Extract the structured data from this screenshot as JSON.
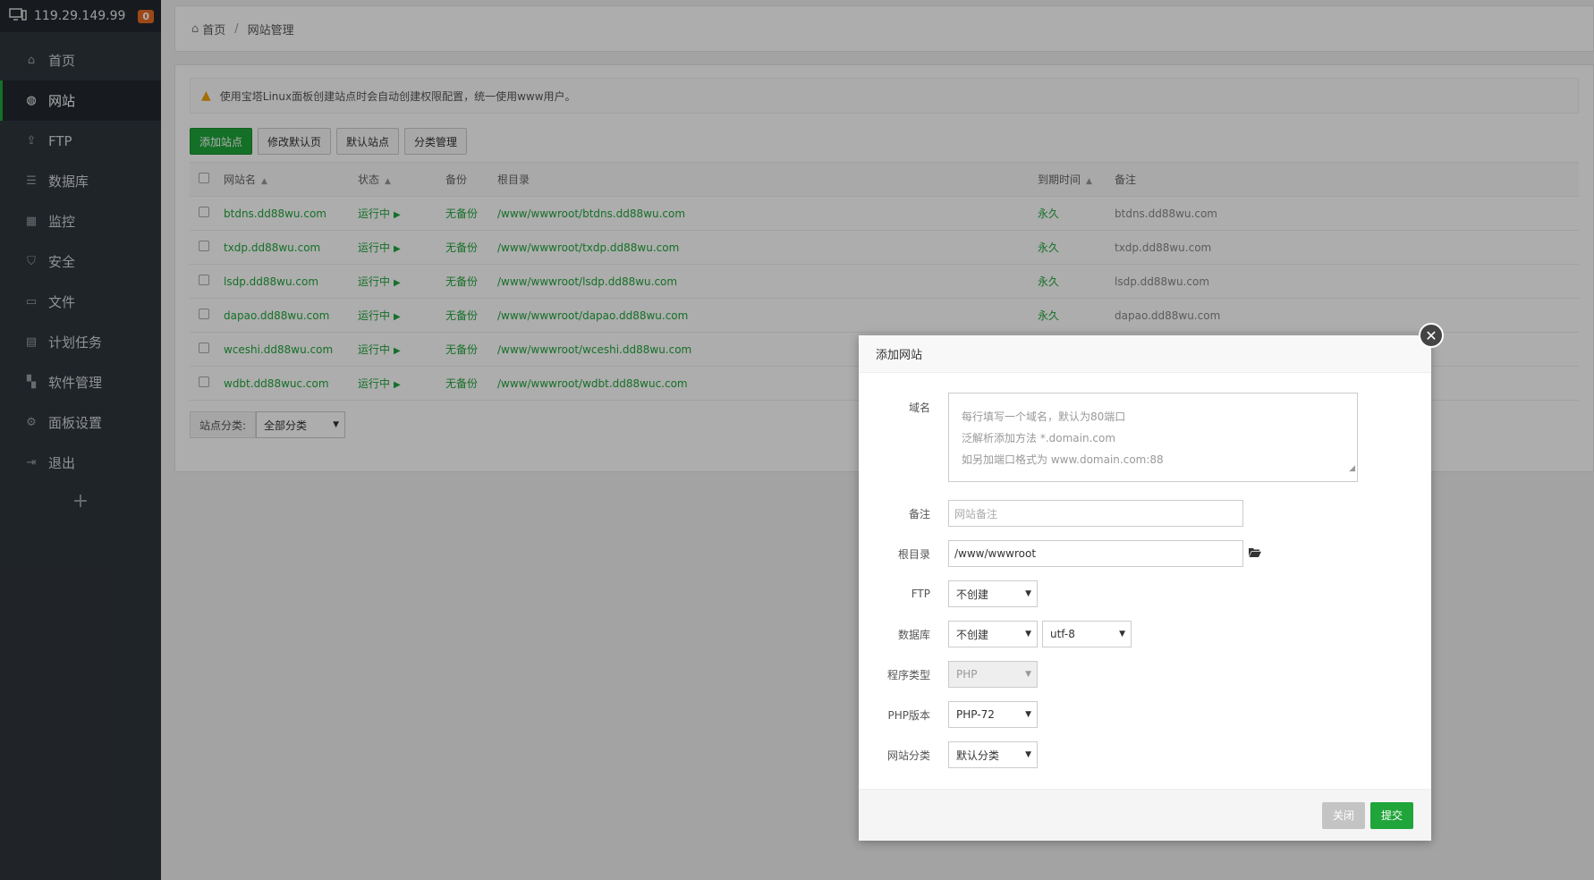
{
  "sidebar": {
    "ip": "119.29.149.99",
    "badge": "0",
    "items": [
      {
        "label": "首页",
        "icon": "home-icon"
      },
      {
        "label": "网站",
        "icon": "globe-icon"
      },
      {
        "label": "FTP",
        "icon": "ftp-icon"
      },
      {
        "label": "数据库",
        "icon": "database-icon"
      },
      {
        "label": "监控",
        "icon": "monitor-icon"
      },
      {
        "label": "安全",
        "icon": "shield-icon"
      },
      {
        "label": "文件",
        "icon": "folder-icon"
      },
      {
        "label": "计划任务",
        "icon": "calendar-icon"
      },
      {
        "label": "软件管理",
        "icon": "grid-icon"
      },
      {
        "label": "面板设置",
        "icon": "gear-icon"
      },
      {
        "label": "退出",
        "icon": "logout-icon"
      }
    ],
    "add": "+"
  },
  "breadcrumb": {
    "home": "首页",
    "sep": "/",
    "current": "网站管理"
  },
  "notice": "使用宝塔Linux面板创建站点时会自动创建权限配置，统一使用www用户。",
  "toolbar": {
    "add_site": "添加站点",
    "edit_default_page": "修改默认页",
    "default_site": "默认站点",
    "category_manage": "分类管理"
  },
  "table": {
    "headers": {
      "name": "网站名",
      "status": "状态",
      "backup": "备份",
      "path": "根目录",
      "expire": "到期时间",
      "note": "备注"
    },
    "rows": [
      {
        "name": "btdns.dd88wu.com",
        "status": "运行中",
        "backup": "无备份",
        "path": "/www/wwwroot/btdns.dd88wu.com",
        "expire": "永久",
        "note": "btdns.dd88wu.com"
      },
      {
        "name": "txdp.dd88wu.com",
        "status": "运行中",
        "backup": "无备份",
        "path": "/www/wwwroot/txdp.dd88wu.com",
        "expire": "永久",
        "note": "txdp.dd88wu.com"
      },
      {
        "name": "lsdp.dd88wu.com",
        "status": "运行中",
        "backup": "无备份",
        "path": "/www/wwwroot/lsdp.dd88wu.com",
        "expire": "永久",
        "note": "lsdp.dd88wu.com"
      },
      {
        "name": "dapao.dd88wu.com",
        "status": "运行中",
        "backup": "无备份",
        "path": "/www/wwwroot/dapao.dd88wu.com",
        "expire": "永久",
        "note": "dapao.dd88wu.com"
      },
      {
        "name": "wceshi.dd88wu.com",
        "status": "运行中",
        "backup": "无备份",
        "path": "/www/wwwroot/wceshi.dd88wu.com",
        "expire": "",
        "note": ""
      },
      {
        "name": "wdbt.dd88wuc.com",
        "status": "运行中",
        "backup": "无备份",
        "path": "/www/wwwroot/wdbt.dd88wuc.com",
        "expire": "",
        "note": ""
      }
    ]
  },
  "filter": {
    "label": "站点分类:",
    "value": "全部分类"
  },
  "modal": {
    "title": "添加网站",
    "domain_label": "域名",
    "domain_placeholder_lines": [
      "每行填写一个域名，默认为80端口",
      "泛解析添加方法 *.domain.com",
      "如另加端口格式为 www.domain.com:88"
    ],
    "note_label": "备注",
    "note_placeholder": "网站备注",
    "root_label": "根目录",
    "root_value": "/www/wwwroot",
    "ftp_label": "FTP",
    "ftp_value": "不创建",
    "db_label": "数据库",
    "db_value": "不创建",
    "db_charset": "utf-8",
    "prog_label": "程序类型",
    "prog_value": "PHP",
    "php_label": "PHP版本",
    "php_value": "PHP-72",
    "cat_label": "网站分类",
    "cat_value": "默认分类",
    "close": "关闭",
    "submit": "提交"
  },
  "colors": {
    "accent": "#20a53a",
    "sidebar_bg": "#2f353d",
    "badge": "#e86a24"
  }
}
